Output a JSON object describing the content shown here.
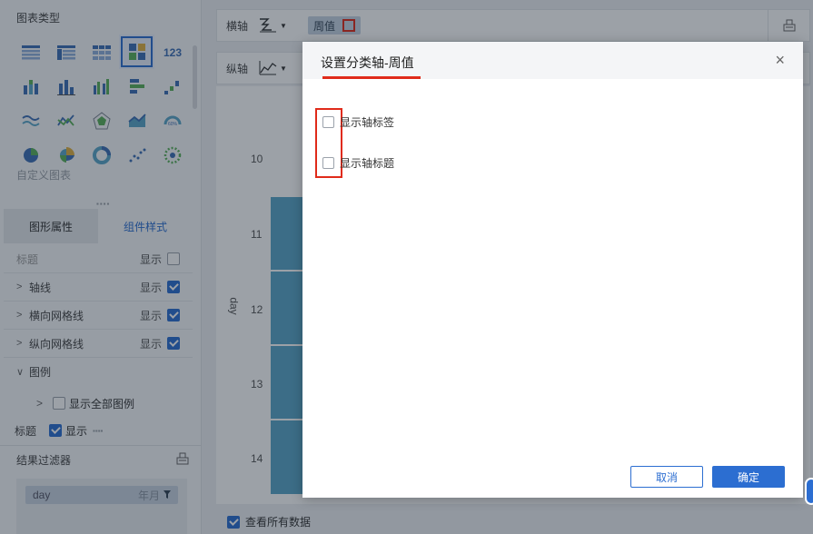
{
  "left_panel": {
    "chart_type_title": "图表类型",
    "custom_chart": "自定义图表",
    "tabs": [
      "图形属性",
      "组件样式"
    ],
    "props": [
      {
        "label": "标题",
        "show": "显示",
        "checked": false
      },
      {
        "label": "轴线",
        "show": "显示",
        "checked": true
      },
      {
        "label": "横向网格线",
        "show": "显示",
        "checked": true
      },
      {
        "label": "纵向网格线",
        "show": "显示",
        "checked": true
      },
      {
        "label": "图例"
      }
    ],
    "show_all_legend": "显示全部图例",
    "title_row": {
      "label": "标题",
      "show": "显示"
    },
    "filter_title": "结果过滤器",
    "filter_field": {
      "name": "day",
      "granularity": "年月"
    }
  },
  "axes": {
    "x_label": "横轴",
    "y_label": "纵轴",
    "x_field": "周值"
  },
  "chart": {
    "y_axis_label": "day",
    "ticks": [
      "10",
      "11",
      "12",
      "13",
      "14"
    ]
  },
  "view_all": "查看所有数据",
  "dialog": {
    "title": "设置分类轴-周值",
    "close": "×",
    "options": [
      "显示轴标签",
      "显示轴标题"
    ],
    "cancel": "取消",
    "ok": "确定"
  },
  "colors": {
    "accent": "#2c6ed1",
    "highlight": "#e02b1a",
    "bar": "#5aa6c9"
  }
}
